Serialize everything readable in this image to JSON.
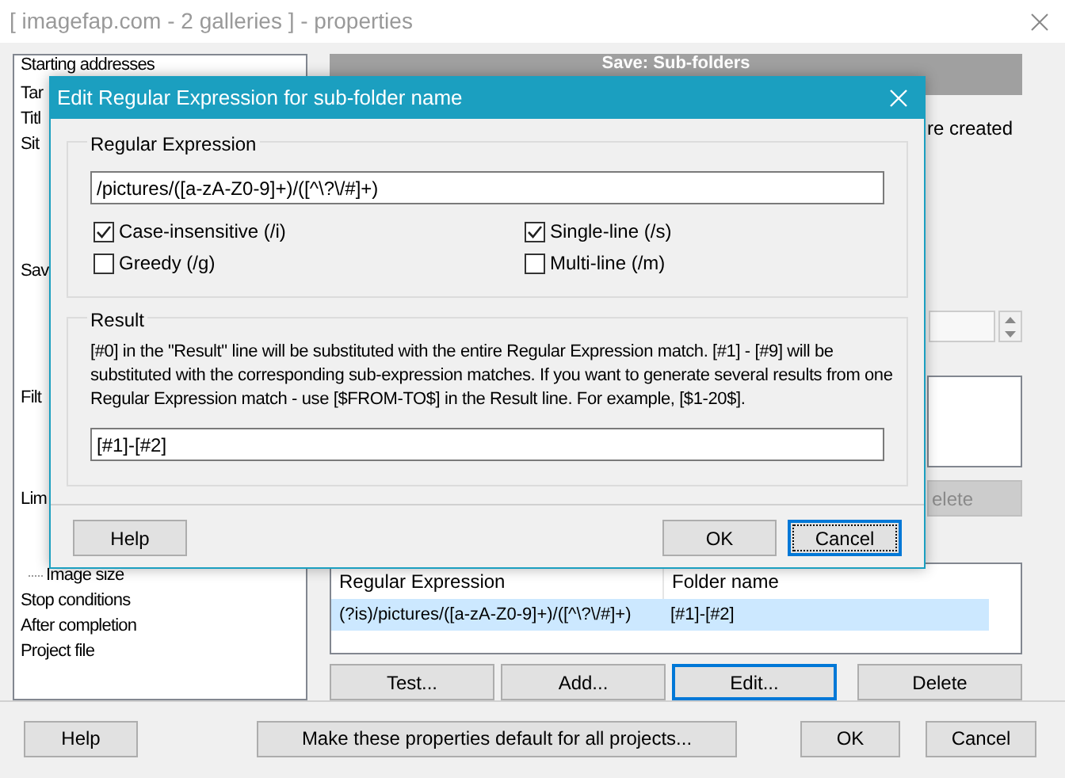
{
  "window": {
    "title": "[ imagefap.com - 2 galleries ] - properties"
  },
  "sidebar": {
    "items": [
      {
        "label": "Starting addresses"
      },
      {
        "label": "Tar"
      },
      {
        "label": "Titl"
      },
      {
        "label": "Sit"
      },
      {
        "label": "Sav"
      },
      {
        "label": "Filt"
      },
      {
        "label": "Lim",
        "children": [
          {
            "label": "Image size"
          }
        ]
      },
      {
        "label": "Stop conditions"
      },
      {
        "label": "After completion"
      },
      {
        "label": "Project file"
      }
    ]
  },
  "panel": {
    "header": "Save: Sub-folders",
    "note": "re created",
    "disabled_button": "elete",
    "table": {
      "columns": [
        "Regular Expression",
        "Folder name"
      ],
      "rows": [
        {
          "cells": [
            "(?is)/pictures/([a-zA-Z0-9]+)/([^\\?\\/#]+)",
            "[#1]-[#2]"
          ],
          "selected": true
        }
      ]
    },
    "buttons": [
      {
        "label": "Test...",
        "focused": false
      },
      {
        "label": "Add...",
        "focused": false
      },
      {
        "label": "Edit...",
        "focused": true
      },
      {
        "label": "Delete",
        "focused": false
      }
    ]
  },
  "footer": {
    "buttons": [
      "Help",
      "Make these properties default for all projects...",
      "OK",
      "Cancel"
    ]
  },
  "dialog": {
    "title": "Edit Regular Expression for sub-folder name",
    "regex_group": {
      "label": "Regular Expression",
      "value": "/pictures/([a-zA-Z0-9]+)/([^\\?\\/#]+)",
      "options": [
        {
          "label": "Case-insensitive (/i)",
          "checked": true
        },
        {
          "label": "Single-line (/s)",
          "checked": true
        },
        {
          "label": "Greedy (/g)",
          "checked": false
        },
        {
          "label": "Multi-line (/m)",
          "checked": false
        }
      ]
    },
    "result_group": {
      "label": "Result",
      "description": "[#0] in the \"Result\" line will be substituted with the entire Regular Expression match. [#1] - [#9] will be substituted with  the corresponding sub-expression matches. If you want to generate several results from one Regular Expression match - use [$FROM-TO$] in the Result line. For example, [$1-20$].",
      "value": "[#1]-[#2]"
    },
    "buttons": [
      {
        "label": "Help",
        "focused": false
      },
      {
        "label": "OK",
        "focused": false
      },
      {
        "label": "Cancel",
        "focused": true
      }
    ]
  }
}
